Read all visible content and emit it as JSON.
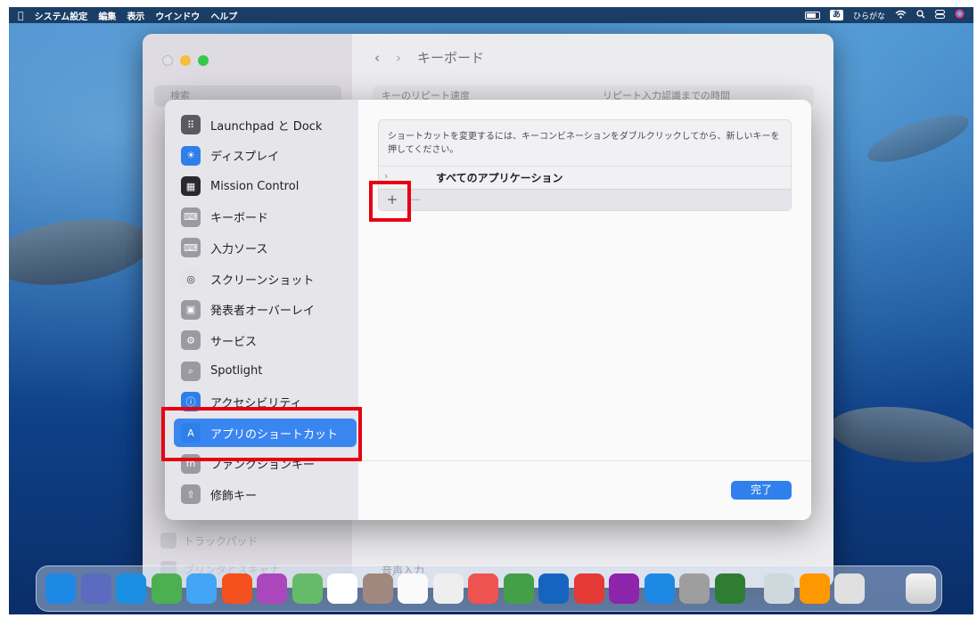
{
  "menubar": {
    "apple": "",
    "items": [
      "システム設定",
      "編集",
      "表示",
      "ウインドウ",
      "ヘルプ"
    ],
    "ime_icon": "あ",
    "ime_label": "ひらがな"
  },
  "settings_window": {
    "title": "キーボード",
    "search_placeholder": "検索",
    "row_left": "キーのリピート速度",
    "row_right": "リピート入力認識までの時間",
    "sidebar_faded": [
      "トラックパッド",
      "プリンタとスキャナ"
    ],
    "main_faded": "音声入力"
  },
  "sheet": {
    "sidebar": [
      {
        "label": "Launchpad と Dock",
        "icon": "launchpad-icon",
        "color": "#5a5a62"
      },
      {
        "label": "ディスプレイ",
        "icon": "display-icon",
        "color": "#2f7fe8"
      },
      {
        "label": "Mission Control",
        "icon": "mission-control-icon",
        "color": "#2a2a2e"
      },
      {
        "label": "キーボード",
        "icon": "keyboard-icon",
        "color": "#9a9aa2"
      },
      {
        "label": "入力ソース",
        "icon": "input-sources-icon",
        "color": "#9a9aa2"
      },
      {
        "label": "スクリーンショット",
        "icon": "screenshot-icon",
        "color": "#e4e4e8"
      },
      {
        "label": "発表者オーバーレイ",
        "icon": "presenter-overlay-icon",
        "color": "#9a9aa2"
      },
      {
        "label": "サービス",
        "icon": "services-icon",
        "color": "#9a9aa2"
      },
      {
        "label": "Spotlight",
        "icon": "spotlight-icon",
        "color": "#9a9aa2"
      },
      {
        "label": "アクセシビリティ",
        "icon": "accessibility-icon",
        "color": "#2f7fe8"
      },
      {
        "label": "アプリのショートカット",
        "icon": "app-shortcuts-icon",
        "color": "#2f7fe8"
      },
      {
        "label": "ファンクションキー",
        "icon": "function-keys-icon",
        "color": "#9a9aa2"
      },
      {
        "label": "修飾キー",
        "icon": "modifier-keys-icon",
        "color": "#9a9aa2"
      }
    ],
    "selected_index": 10,
    "instructions": "ショートカットを変更するには、キーコンビネーションをダブルクリックしてから、新しいキーを押してください。",
    "all_apps": "すべてのアプリケーション",
    "add_symbol": "+",
    "remove_symbol": "−",
    "done_label": "完了"
  },
  "dock": {
    "app_colors": [
      "#1e88e5",
      "#5c6bc0",
      "#1a8fe3",
      "#4caf50",
      "#42a5f5",
      "#f4511e",
      "#ab47bc",
      "#66bb6a",
      "#ffffff",
      "#a1887f",
      "#fafafa",
      "#eeeeee",
      "#ef5350",
      "#43a047",
      "#1565c0",
      "#e53935",
      "#8e24aa",
      "#1e88e5",
      "#9e9e9e",
      "#2e7d32",
      "#cfd8dc",
      "#ff9800",
      "#e0e0e0"
    ]
  }
}
